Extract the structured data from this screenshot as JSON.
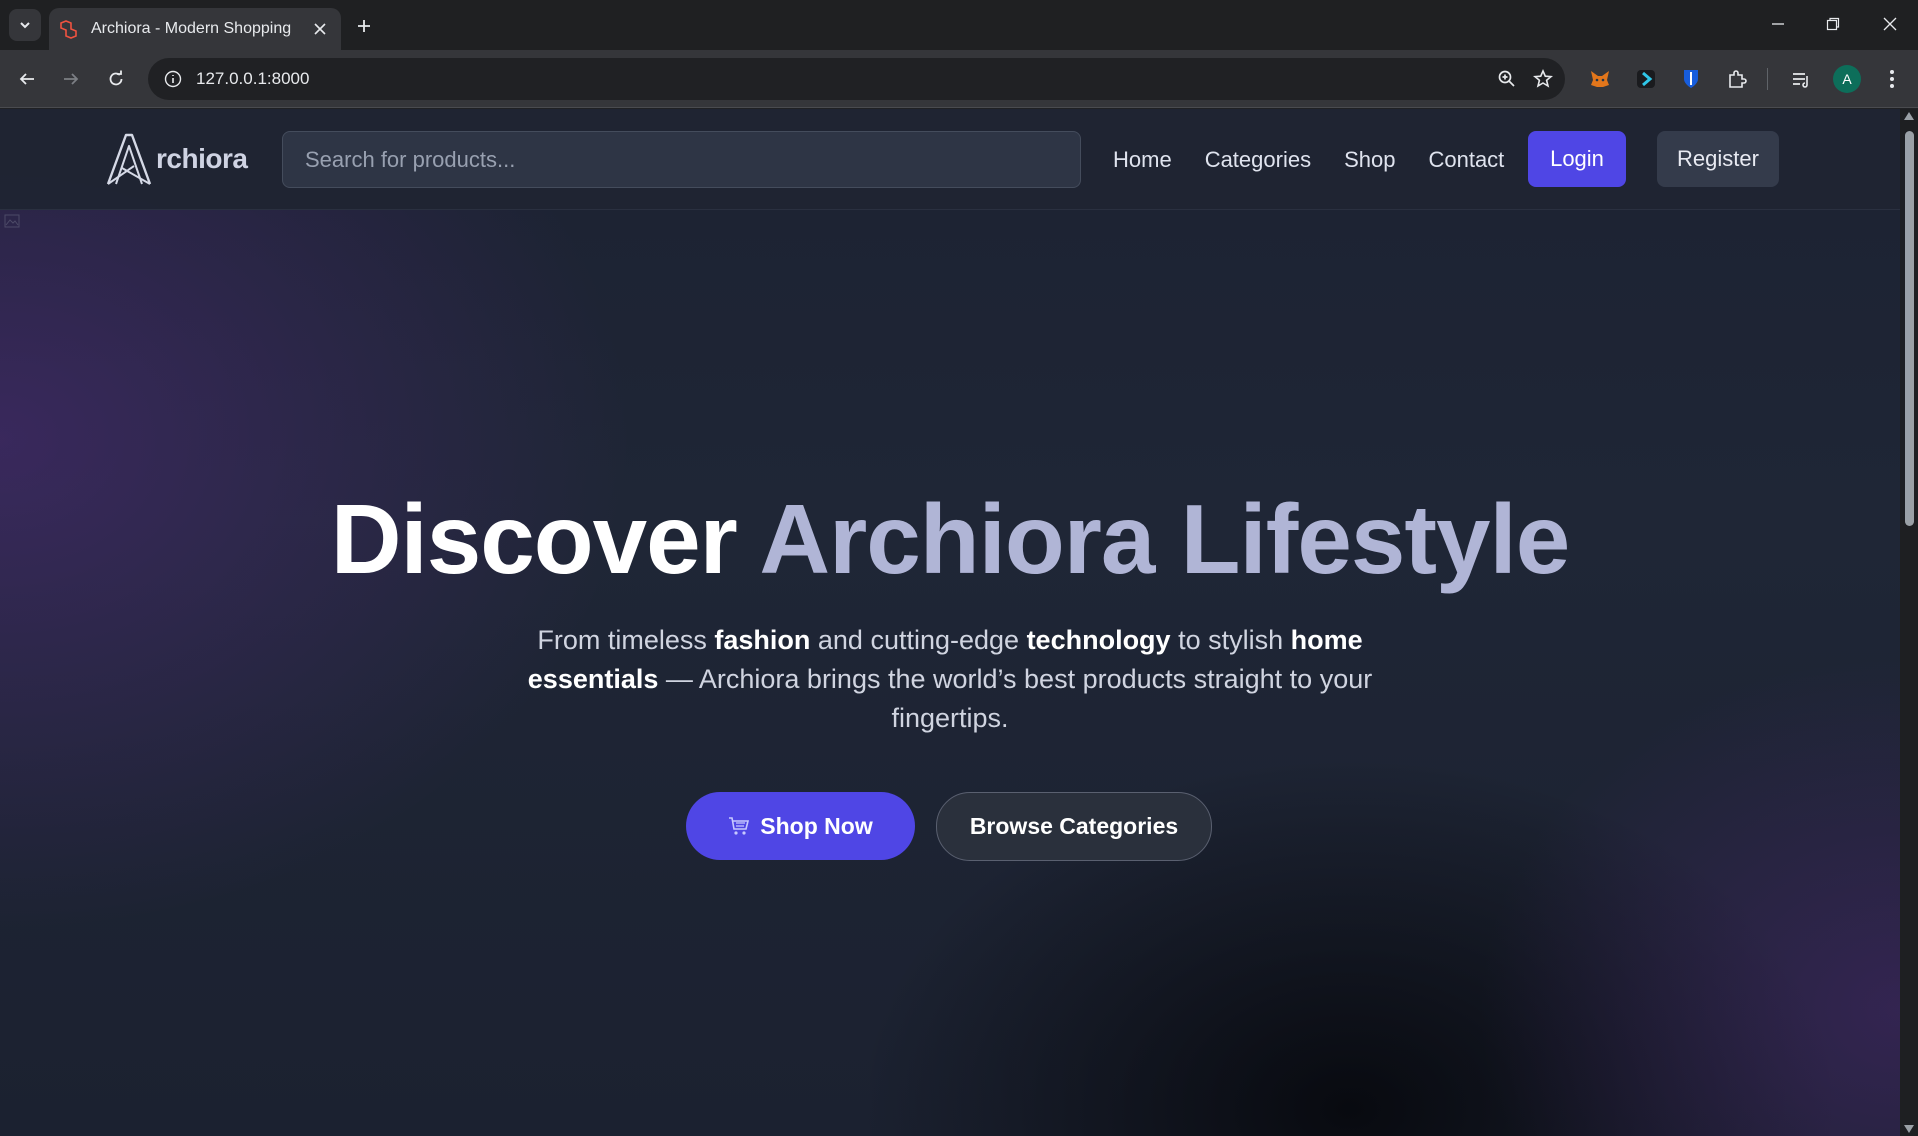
{
  "browser": {
    "tab_title": "Archiora - Modern Shopping",
    "url": "127.0.0.1:8000",
    "profile_initial": "A"
  },
  "header": {
    "logo_text": "rchiora",
    "search_placeholder": "Search for products...",
    "nav": [
      "Home",
      "Categories",
      "Shop",
      "Contact"
    ],
    "login_label": "Login",
    "register_label": "Register"
  },
  "hero": {
    "title_part1": "Discover",
    "title_part2": "Archiora Lifestyle",
    "subtitle": {
      "t1": "From timeless ",
      "b1": "fashion",
      "t2": " and cutting-edge ",
      "b2": "technology",
      "t3": " to stylish ",
      "b3": "home essentials",
      "t4": " — Archiora brings the world’s best products straight to your fingertips."
    },
    "shop_now_label": "Shop Now",
    "browse_label": "Browse Categories"
  },
  "colors": {
    "accent": "#4f46e5",
    "title_secondary": "#b0b5d6"
  }
}
